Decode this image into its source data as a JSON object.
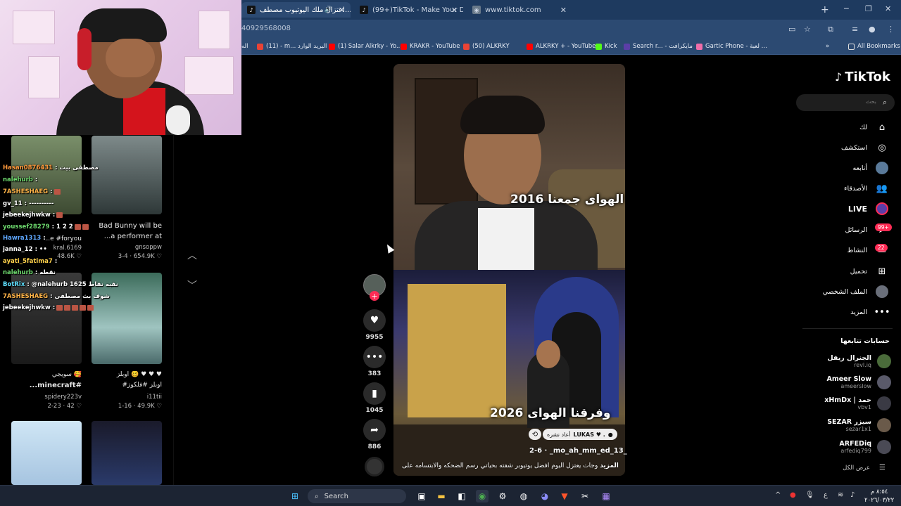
{
  "browser": {
    "tabs": [
      {
        "label": "اعتزال ملك اليوتيوب مصطف..."
      },
      {
        "label": "(99+)TikTok - Make Your Day"
      },
      {
        "label": "www.tiktok.com"
      }
    ],
    "url": "40929568008",
    "bookmarks": [
      {
        "label": "(11) - m... البريد الوارد"
      },
      {
        "label": "(1) Salar Alkrky - Yo..."
      },
      {
        "label": "KRAKR - YouTube"
      },
      {
        "label": "(50) ALKRKY"
      },
      {
        "label": "ALKRKY + - YouTube"
      },
      {
        "label": "Kick"
      },
      {
        "label": "Search r... - مايكرافت"
      },
      {
        "label": "Gartic Phone - لعبة ..."
      },
      {
        "label": "All Bookmarks"
      }
    ],
    "accent": "#1e3a5f"
  },
  "chat": [
    {
      "name": "Hasan0876431",
      "text": ": مصطفى بيت",
      "color": "#ff9a3c"
    },
    {
      "name": "nalehurb",
      "text": ":",
      "color": "#6fdc6f"
    },
    {
      "name": "7ASHESHAEG",
      "text": ":",
      "color": "#ffb347"
    },
    {
      "name": "gv_11",
      "text": ": ----------",
      "color": "#ffffff"
    },
    {
      "name": "jebeekejhwkw",
      "text": ":",
      "color": "#ffffff"
    },
    {
      "name": "youssef28279",
      "text": ": 1 2 2",
      "color": "#6fdc6f"
    },
    {
      "name": "Hawra1313",
      "text": ":",
      "color": "#5fa8ff"
    },
    {
      "name": "janna_12",
      "text": ": ••",
      "color": "#ffffff"
    },
    {
      "name": "ayati_5fatima7",
      "text": ":",
      "color": "#ffd24c"
    },
    {
      "name": "nalehurb",
      "text": ": نقطه",
      "color": "#6fdc6f"
    },
    {
      "name": "BotRix",
      "text": ": @nalehurb 1625 نقيه نقاط",
      "color": "#5fe0ff"
    },
    {
      "name": "7ASHESHAEG",
      "text": ": شوف بث مصطفى",
      "color": "#ffb347"
    },
    {
      "name": "jebeekejhwkw",
      "text": ":",
      "color": "#ffffff"
    }
  ],
  "feed": {
    "items": [
      {
        "caption": "...e #foryou",
        "meta": "kral.6169",
        "stats": "48.6K ♡"
      },
      {
        "caption": "Bad Bunny will be",
        "caption2": "...a performer at",
        "meta": "gnsoppw",
        "stats": "3-4 · 654.9K ♡"
      },
      {
        "caption": "سويجي 🥰",
        "caption2": "...minecraft#",
        "meta": "spidery223v",
        "stats": "2-23 · 42 ♡"
      },
      {
        "caption": "اوبلز 🥴 ♥ ♥ ♥",
        "caption2": "#اوبلز #فلكوز",
        "meta": "i11tii",
        "stats": "1-16 · 49.9K ♡"
      }
    ]
  },
  "video": {
    "overlay_top": "الهواى جمعنا 2016",
    "overlay_bottom": "وفرقنا الهواى 2026",
    "reposted_label": "أعاد نشره",
    "reposted_by": "LUKAS ♥ .",
    "author": "_mo_ah_mm_ed_13_",
    "date": "2-6",
    "description": "وجات يعتزل اليوم افضل يوتيوبر شفته بحياتي رسم الضحكه والابتسامه على",
    "more": "المزيد",
    "likes": "9955",
    "comments": "383",
    "saves": "1045",
    "shares": "886"
  },
  "sidebar": {
    "logo": "TikTok",
    "search_placeholder": "بحث",
    "nav": [
      {
        "label": "لك",
        "icon": "home-icon"
      },
      {
        "label": "استكشف",
        "icon": "compass-icon"
      },
      {
        "label": "أتابعه",
        "icon": "avatar-icon"
      },
      {
        "label": "الأصدقاء",
        "icon": "friends-icon"
      },
      {
        "label": "LIVE",
        "icon": "live-icon"
      },
      {
        "label": "الرسائل",
        "icon": "messages-icon",
        "badge": "99+"
      },
      {
        "label": "النشاط",
        "icon": "activity-icon",
        "badge": "22"
      },
      {
        "label": "تحميل",
        "icon": "upload-icon"
      },
      {
        "label": "الملف الشخصي",
        "icon": "profile-icon"
      },
      {
        "label": "المزيد",
        "icon": "more-icon"
      }
    ],
    "following_title": "حسابات تتابعها",
    "following": [
      {
        "name": "الجنرال ريفل",
        "handle": "revl.iq",
        "color": "#4a6b3a"
      },
      {
        "name": "Ameer Slow",
        "handle": "ameerslow",
        "color": "#5a5a6a"
      },
      {
        "name": "xHmDx | حمد",
        "handle": "vbv1",
        "color": "#3a3a44"
      },
      {
        "name": "SEZAR سيزر",
        "handle": "sezar1x1",
        "color": "#6a5a4a"
      },
      {
        "name": "ARFEDiq",
        "handle": "arfediq799",
        "color": "#4a4a55"
      }
    ],
    "see_all": "عرض الكل"
  },
  "taskbar": {
    "search": "Search",
    "time": "٨:٥٤ م",
    "date": "٢٠٢٦/٠٣/٢٢",
    "lang": "ع"
  }
}
